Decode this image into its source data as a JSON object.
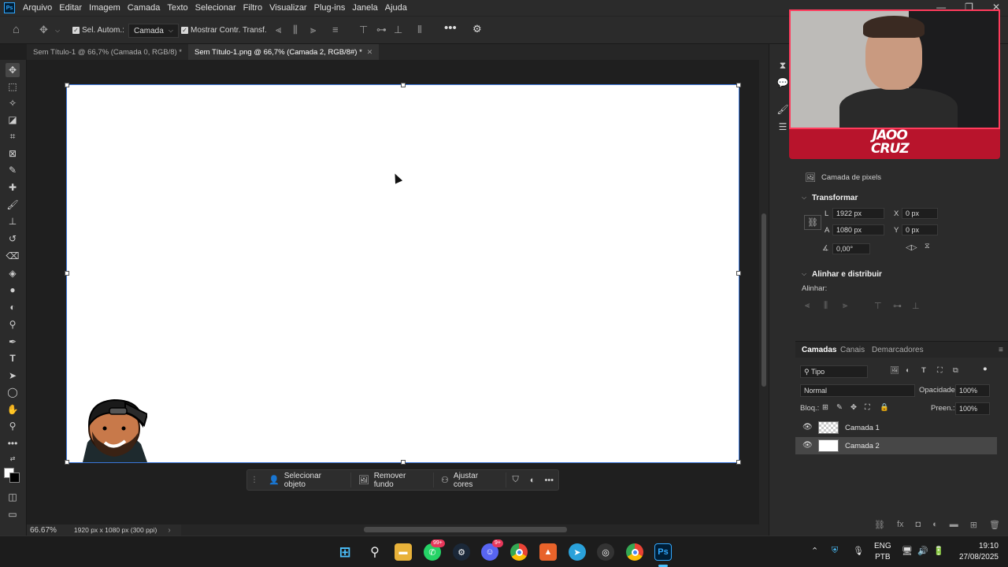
{
  "menu": {
    "items": [
      "Arquivo",
      "Editar",
      "Imagem",
      "Camada",
      "Texto",
      "Selecionar",
      "Filtro",
      "Visualizar",
      "Plug-ins",
      "Janela",
      "Ajuda"
    ]
  },
  "optbar": {
    "auto_select_label": "Sel. Autom.:",
    "auto_select_target": "Camada",
    "show_transform_label": "Mostrar Contr. Transf."
  },
  "tabs": [
    {
      "label": "Sem Título-1 @ 66,7% (Camada 0, RGB/8) *",
      "active": false
    },
    {
      "label": "Sem Título-1.png @ 66,7% (Camada 2, RGB/8#) *",
      "active": true
    }
  ],
  "context_bar": {
    "select_object": "Selecionar objeto",
    "remove_bg": "Remover fundo",
    "adjust_colors": "Ajustar cores"
  },
  "status": {
    "zoom": "66.67%",
    "doc_info": "1920 px x 1080 px (300 ppi)"
  },
  "properties": {
    "layer_type": "Camada de pixels",
    "transform_title": "Transformar",
    "w_label": "L",
    "w_value": "1922 px",
    "h_label": "A",
    "h_value": "1080 px",
    "x_label": "X",
    "x_value": "0 px",
    "y_label": "Y",
    "y_value": "0 px",
    "angle_value": "0,00°",
    "align_title": "Alinhar e distribuir",
    "align_label": "Alinhar:"
  },
  "layers_panel": {
    "tabs": [
      "Camadas",
      "Canais",
      "Demarcadores"
    ],
    "filter_label": "Tipo",
    "blend_mode": "Normal",
    "opacity_label": "Opacidade:",
    "opacity_value": "100%",
    "lock_label": "Bloq.:",
    "fill_label": "Preen.:",
    "fill_value": "100%",
    "layers": [
      {
        "name": "Camada 1",
        "selected": false
      },
      {
        "name": "Camada 2",
        "selected": true
      }
    ]
  },
  "webcam": {
    "logo_line1": "JAOO",
    "logo_line2": "CRUZ"
  },
  "taskbar": {
    "whatsapp_badge": "99+",
    "discord_badge": "9+",
    "ps_label": "Ps",
    "lang_top": "ENG",
    "lang_bottom": "PTB",
    "time": "19:10",
    "date": "27/08/2025"
  },
  "colors": {
    "accent_blue": "#3b76d9",
    "webcam_border": "#ff3b5c",
    "webcam_banner": "#b8142c",
    "ps_blue": "#31a8ff"
  }
}
